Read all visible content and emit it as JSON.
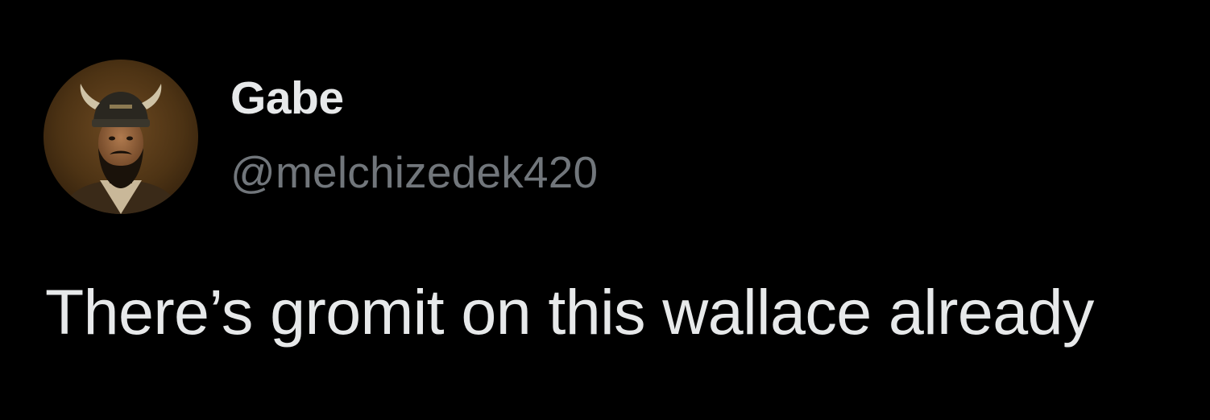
{
  "tweet": {
    "author": {
      "display_name": "Gabe",
      "handle": "@melchizedek420",
      "avatar_icon": "profile-portrait-avatar"
    },
    "text": "There’s gromit on this wallace already"
  },
  "colors": {
    "background": "#000000",
    "display_name": "#e7e9ea",
    "handle": "#71767b",
    "text": "#e7e9ea"
  }
}
